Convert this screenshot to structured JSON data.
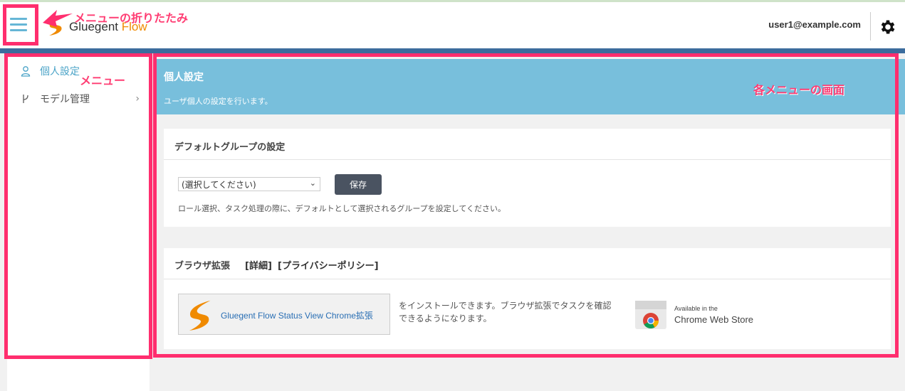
{
  "header": {
    "logo_text_main": "Gluegent",
    "logo_text_accent": "Flow",
    "user_email": "user1@example.com"
  },
  "sidebar": {
    "items": [
      {
        "label": "個人設定",
        "icon": "user-icon",
        "active": true
      },
      {
        "label": "モデル管理",
        "icon": "branch-icon",
        "active": false,
        "chevron": "›"
      }
    ]
  },
  "hero": {
    "title": "個人設定",
    "subtitle": "ユーザ個人の設定を行います。"
  },
  "default_group": {
    "title": "デフォルトグループの設定",
    "select_value": "(選択してください)",
    "save_label": "保存",
    "help_text": "ロール選択、タスク処理の際に、デフォルトとして選択されるグループを設定してください。"
  },
  "browser_ext": {
    "title": "ブラウザ拡張",
    "details_link": "[詳細]",
    "privacy_link": "[プライバシーポリシー]",
    "extension_label": "Gluegent Flow Status View Chrome拡張",
    "description": "をインストールできます。ブラウザ拡張でタスクを確認できるようになります。",
    "store_small": "Available in the",
    "store_big": "Chrome Web Store"
  },
  "annotations": {
    "collapse_label": "メニューの折りたたみ",
    "menu_label": "メニュー",
    "screen_label": "各メニューの画面",
    "color": "#ff2e6e"
  }
}
